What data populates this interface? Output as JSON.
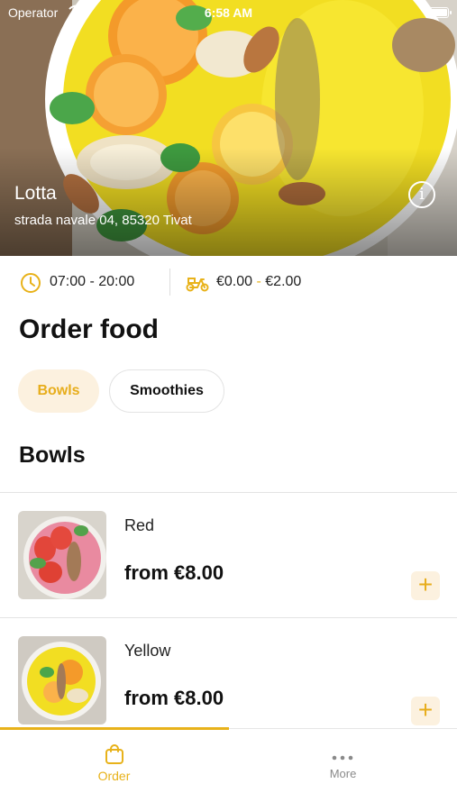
{
  "status_bar": {
    "carrier": "Operator",
    "time": "6:58 AM"
  },
  "restaurant": {
    "name": "Lotta",
    "address": "strada navale 04, 85320 Tivat",
    "info_icon": "info-icon"
  },
  "info_row": {
    "hours": "07:00 - 20:00",
    "delivery_fee_min": "€0.00",
    "delivery_fee_separator": "-",
    "delivery_fee_max": "€2.00"
  },
  "page_title": "Order food",
  "categories": [
    {
      "label": "Bowls",
      "selected": true
    },
    {
      "label": "Smoothies",
      "selected": false
    }
  ],
  "section_title": "Bowls",
  "items": [
    {
      "name": "Red",
      "price": "from €8.00",
      "add_label": "+"
    },
    {
      "name": "Yellow",
      "price": "from €8.00",
      "add_label": "+"
    }
  ],
  "tabs": [
    {
      "label": "Order",
      "icon": "shopping-bag-icon",
      "active": true
    },
    {
      "label": "More",
      "icon": "more-dots-icon",
      "active": false
    }
  ],
  "colors": {
    "accent": "#e8b21a",
    "accent_light": "#fcf1df"
  }
}
